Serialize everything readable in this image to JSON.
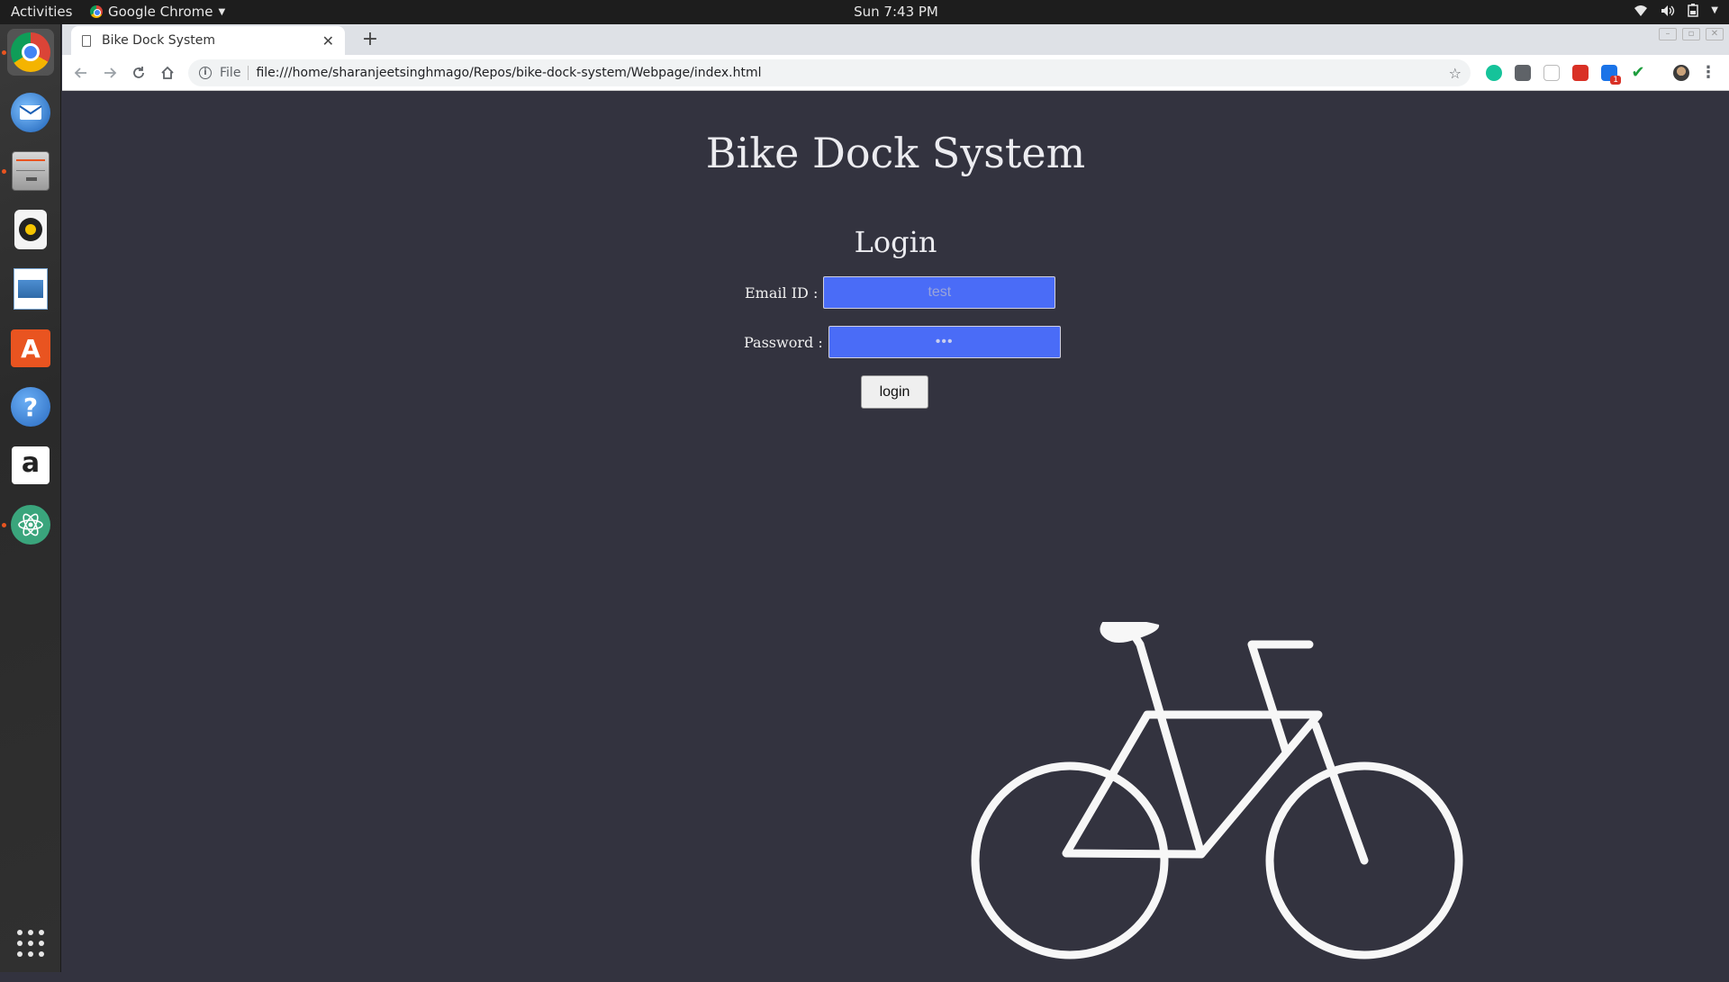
{
  "topbar": {
    "activities": "Activities",
    "app_name": "Google Chrome",
    "clock": "Sun  7:43 PM"
  },
  "browser": {
    "tab_title": "Bike Dock System",
    "new_tab": "+",
    "scheme_label": "File",
    "url": "file:///home/sharanjeetsinghmago/Repos/bike-dock-system/Webpage/index.html",
    "extension_badge": "1"
  },
  "page": {
    "title": "Bike Dock System",
    "login_heading": "Login",
    "email_label": "Email ID :",
    "email_value": "test",
    "password_label": "Password :",
    "password_value": "•••",
    "login_button": "login"
  },
  "colors": {
    "page_background": "#33333f",
    "input_background": "#4a6cf7",
    "bike": "#f7f7f7"
  },
  "icons": {
    "dock": [
      "chrome-icon",
      "thunderbird-icon",
      "files-icon",
      "rhythmbox-icon",
      "libreoffice-impress-icon",
      "software-center-icon",
      "help-icon",
      "amazon-icon",
      "atom-icon",
      "show-apps-icon"
    ]
  }
}
